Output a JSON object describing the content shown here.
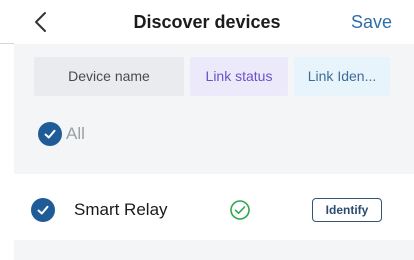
{
  "header": {
    "title": "Discover devices",
    "save_label": "Save",
    "back_icon": "chevron-left-icon"
  },
  "columns": [
    {
      "label": "Device name",
      "bg": "#e9ebee",
      "color": "#4a4a4a"
    },
    {
      "label": "Link status",
      "bg": "#ece9fb",
      "color": "#6b52c7"
    },
    {
      "label": "Link Iden...",
      "bg": "#e8f4fc",
      "color": "#3f6d93"
    }
  ],
  "select_all": {
    "label": "All",
    "checked": true
  },
  "devices": [
    {
      "name": "Smart Relay",
      "selected": true,
      "link_status_icon": "check-circle-icon",
      "identify_label": "Identify"
    }
  ],
  "colors": {
    "accent": "#1f5c97",
    "status_ok": "#2fa84f",
    "muted_text": "#9aa0a6",
    "save_text": "#2f6fa6",
    "identify_text": "#2b4c6f"
  }
}
